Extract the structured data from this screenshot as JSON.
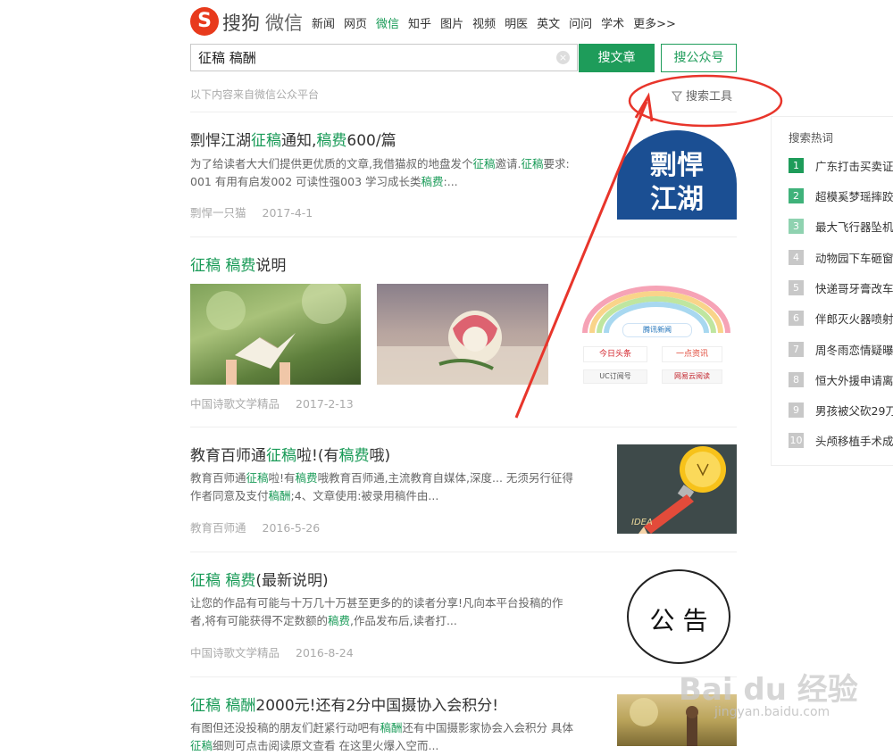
{
  "header": {
    "logo_letter": "S",
    "logo_sougou": "搜狗",
    "logo_weixin": "微信",
    "nav": [
      "新闻",
      "网页",
      "微信",
      "知乎",
      "图片",
      "视频",
      "明医",
      "英文",
      "问问",
      "学术",
      "更多>>"
    ],
    "nav_active_index": 2
  },
  "search": {
    "query": "征稿 稿酬",
    "clear_icon": "×",
    "search_articles": "搜文章",
    "search_accounts": "搜公众号"
  },
  "source_note": "以下内容来自微信公众平台",
  "search_tools": "搜索工具",
  "results": [
    {
      "title_parts": [
        "剽悍江湖",
        "征稿",
        "通知,",
        "稿费",
        "600/篇"
      ],
      "desc_line1": [
        "为了给读者大大们提供更优质的文章,我借猫叔的地盘发个",
        "征稿",
        "邀请.",
        "征稿",
        "要求:"
      ],
      "desc_line2": [
        "001 有用有启发002 可读性强003 学习成长类",
        "稿费",
        ":..."
      ],
      "author": "剽悍一只猫",
      "date": "2017-4-1",
      "thumb_text_1": "剽悍",
      "thumb_text_2": "江湖"
    },
    {
      "title_parts": [
        "征稿",
        " ",
        "稿费",
        "说明"
      ],
      "author": "中国诗歌文学精品",
      "date": "2017-2-13",
      "news_badges": [
        "今日头条",
        "一点资讯",
        "UC订阅号",
        "网易云阅读"
      ],
      "news_top": "腾讯新闻"
    },
    {
      "title_parts": [
        "教育百师通",
        "征稿",
        "啦!(有",
        "稿费",
        "哦)"
      ],
      "desc_line1": [
        "教育百师通",
        "征稿",
        "啦!有",
        "稿费",
        "哦教育百师通,主流教育自媒体,深度... 无须另行征得"
      ],
      "desc_line2": [
        "作者同意及支付",
        "稿酬",
        ";4、文章使用:被录用稿件由..."
      ],
      "author": "教育百师通",
      "date": "2016-5-26",
      "thumb_text": "IDEA"
    },
    {
      "title_parts": [
        "征稿",
        " ",
        "稿费",
        "(最新说明)"
      ],
      "desc_line1": [
        "让您的作品有可能与十万几十万甚至更多的的读者分享!凡向本平台投稿的作"
      ],
      "desc_line2": [
        "者,将有可能获得不定数额的",
        "稿费",
        ",作品发布后,读者打..."
      ],
      "author": "中国诗歌文学精品",
      "date": "2016-8-24",
      "thumb_text": "公 告"
    },
    {
      "title_parts": [
        "征稿",
        " ",
        "稿酬",
        "2000元!还有2分中国摄协入会积分!"
      ],
      "desc_line1": [
        "有图但还没投稿的朋友们赶紧行动吧有",
        "稿酬",
        "还有中国摄影家协会入会积分 具体"
      ],
      "desc_line2": [
        "征稿",
        "细则可点击阅读原文查看 在这里火爆入空而..."
      ]
    }
  ],
  "sidebar": {
    "title": "搜索热词",
    "items": [
      {
        "rank": "1",
        "label": "广东打击买卖证"
      },
      {
        "rank": "2",
        "label": "超模奚梦瑶摔跤"
      },
      {
        "rank": "3",
        "label": "最大飞行器坠机"
      },
      {
        "rank": "4",
        "label": "动物园下车砸窗"
      },
      {
        "rank": "5",
        "label": "快递哥牙膏改车"
      },
      {
        "rank": "6",
        "label": "伴郎灭火器喷射"
      },
      {
        "rank": "7",
        "label": "周冬雨恋情疑曝"
      },
      {
        "rank": "8",
        "label": "恒大外援申请离"
      },
      {
        "rank": "9",
        "label": "男孩被父砍29刀"
      },
      {
        "rank": "10",
        "label": "头颅移植手术成"
      }
    ]
  },
  "watermark": {
    "brand": "Bai du 经验",
    "url": "jingyan.baidu.com"
  },
  "colors": {
    "brand_green": "#1e9c5a",
    "highlight": "#1a9b58",
    "logo_red": "#e83a1c",
    "annotation_red": "#e8352b"
  }
}
